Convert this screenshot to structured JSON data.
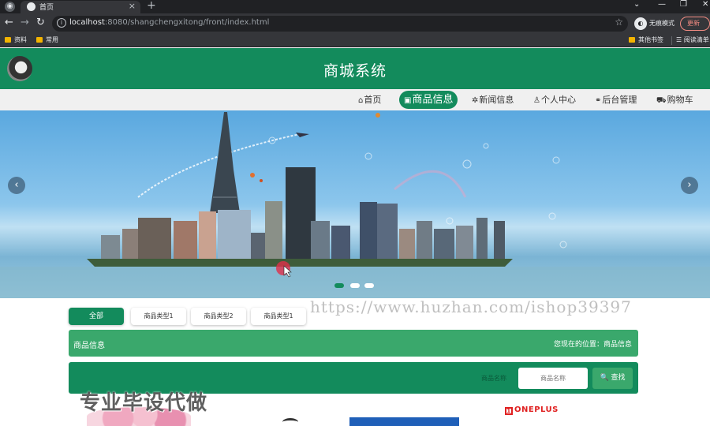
{
  "browser": {
    "tab_title": "首页",
    "close_glyph": "×",
    "new_tab_glyph": "+",
    "url_host": "localhost",
    "url_path": ":8080/shangchengxitong/front/index.html",
    "incognito_label": "无痕模式",
    "update_label": "更新",
    "bookmarks": [
      "资料",
      "常用",
      "其他书签",
      "阅读清单"
    ]
  },
  "header": {
    "title": "商城系统"
  },
  "nav": {
    "items": [
      {
        "icon": "⌂",
        "label": "首页"
      },
      {
        "icon": "▣",
        "label": "商品信息"
      },
      {
        "icon": "✲",
        "label": "新闻信息"
      },
      {
        "icon": "♙",
        "label": "个人中心"
      },
      {
        "icon": "⚭",
        "label": "后台管理"
      },
      {
        "icon": "⛟",
        "label": "购物车"
      }
    ],
    "active_index": 1
  },
  "carousel": {
    "prev_glyph": "‹",
    "next_glyph": "›",
    "slide_count": 3,
    "active_slide": 0
  },
  "filters": {
    "items": [
      "全部",
      "商品类型1",
      "商品类型2",
      "商品类型1"
    ],
    "active_index": 0
  },
  "overlay": {
    "url_watermark": "https://www.huzhan.com/ishop39397",
    "text_watermark": "专业毕设代做"
  },
  "breadcrumb": {
    "title": "商品信息",
    "location_label": "您现在的位置：",
    "location_value": "商品信息"
  },
  "search": {
    "label": "商品名称",
    "placeholder": "商品名称",
    "button_icon": "🔍",
    "button_label": "查找"
  },
  "products": {
    "brand": "ONEPLUS",
    "brand_mark": "1"
  },
  "colors": {
    "primary": "#138b5c",
    "secondary": "#3aa86c",
    "nav_bg": "#f0f0f0"
  }
}
